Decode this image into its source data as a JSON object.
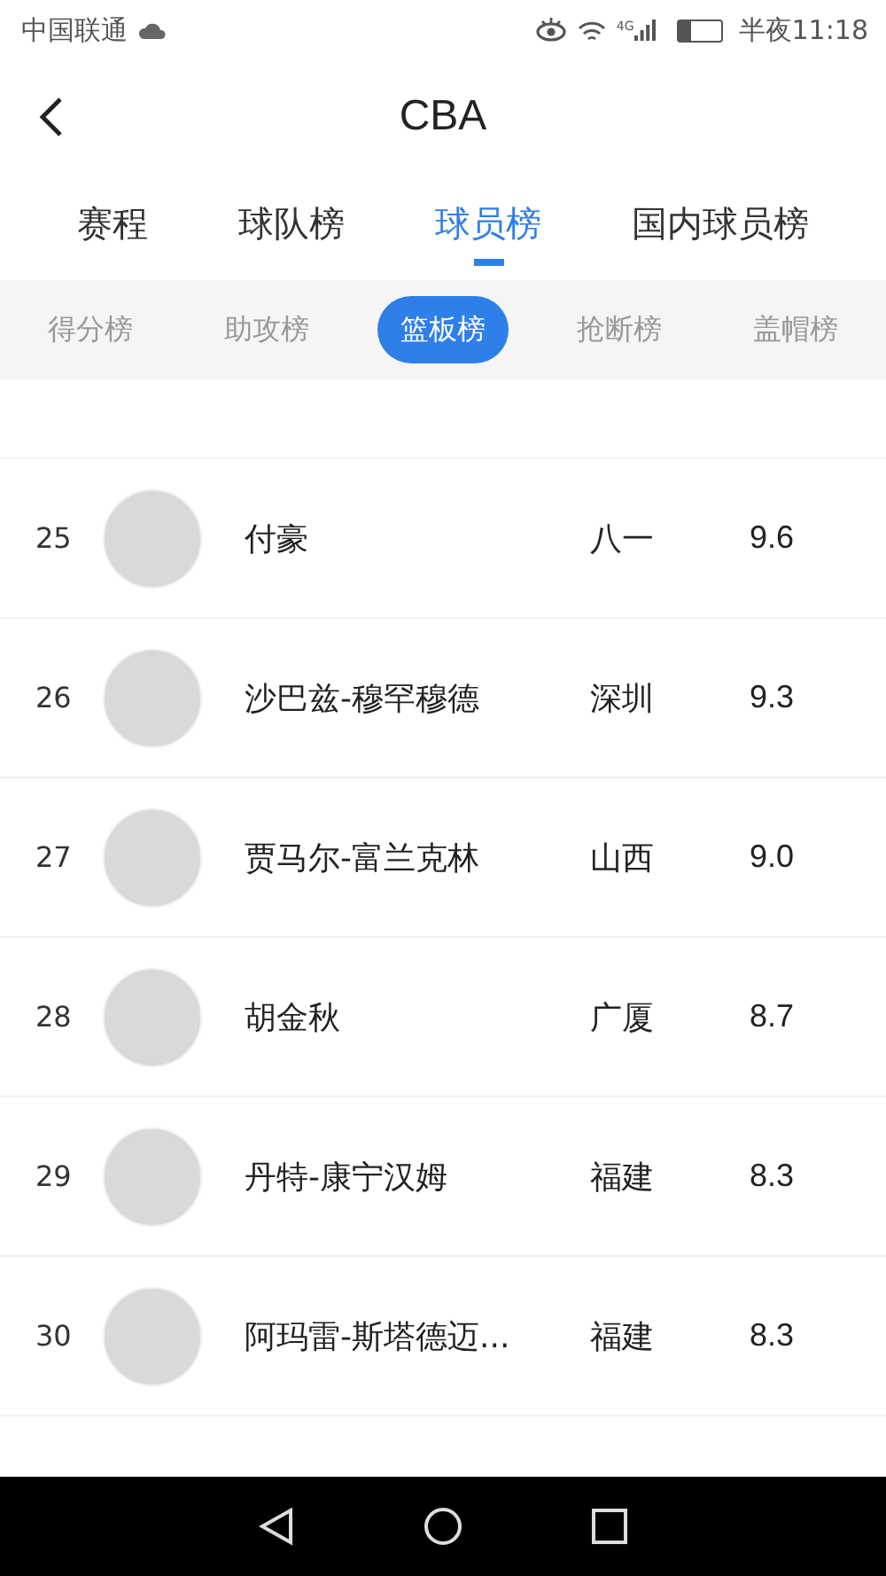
{
  "status_bar": {
    "carrier": "中国联通",
    "time": "半夜11:18",
    "network": "4G",
    "battery": {
      "level": 0.3
    }
  },
  "header": {
    "title": "CBA"
  },
  "tabs": [
    {
      "label": "赛程",
      "selected": false
    },
    {
      "label": "球队榜",
      "selected": false
    },
    {
      "label": "球员榜",
      "selected": true
    },
    {
      "label": "国内球员榜",
      "selected": false
    }
  ],
  "subtabs": [
    {
      "label": "得分榜",
      "selected": false
    },
    {
      "label": "助攻榜",
      "selected": false
    },
    {
      "label": "篮板榜",
      "selected": true
    },
    {
      "label": "抢断榜",
      "selected": false
    },
    {
      "label": "盖帽榜",
      "selected": false
    }
  ],
  "rows": [
    {
      "rank": "25",
      "name": "付豪",
      "team": "八一",
      "value": "9.6"
    },
    {
      "rank": "26",
      "name": "沙巴兹-穆罕穆德",
      "team": "深圳",
      "value": "9.3"
    },
    {
      "rank": "27",
      "name": "贾马尔-富兰克林",
      "team": "山西",
      "value": "9.0"
    },
    {
      "rank": "28",
      "name": "胡金秋",
      "team": "广厦",
      "value": "8.7"
    },
    {
      "rank": "29",
      "name": "丹特-康宁汉姆",
      "team": "福建",
      "value": "8.3"
    },
    {
      "rank": "30",
      "name": "阿玛雷-斯塔德迈...",
      "team": "福建",
      "value": "8.3"
    }
  ]
}
